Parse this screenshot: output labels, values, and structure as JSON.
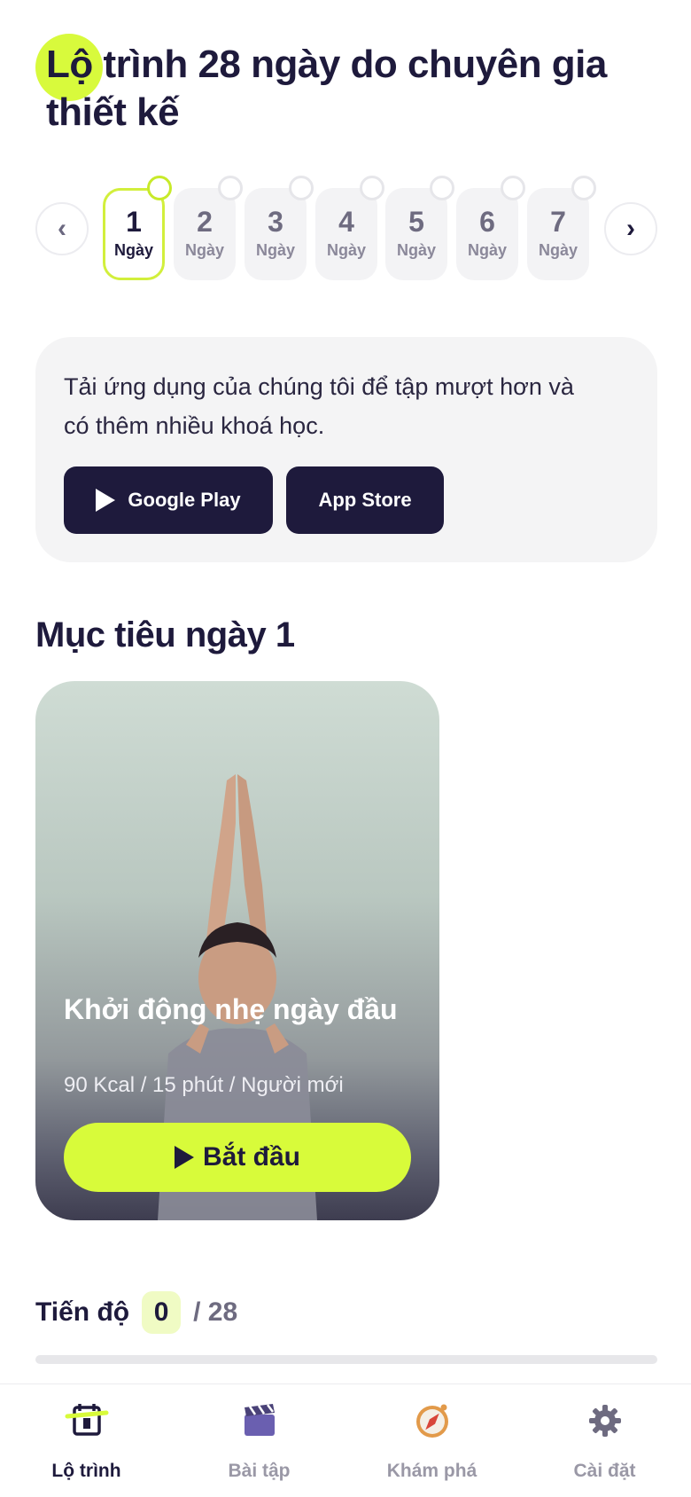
{
  "header": {
    "title": "Lộ trình 28 ngày do chuyên gia thiết kế"
  },
  "day_selector": {
    "prev_symbol": "‹",
    "next_symbol": "›",
    "days": [
      {
        "number": "1",
        "label": "Ngày",
        "active": true
      },
      {
        "number": "2",
        "label": "Ngày",
        "active": false
      },
      {
        "number": "3",
        "label": "Ngày",
        "active": false
      },
      {
        "number": "4",
        "label": "Ngày",
        "active": false
      },
      {
        "number": "5",
        "label": "Ngày",
        "active": false
      },
      {
        "number": "6",
        "label": "Ngày",
        "active": false
      },
      {
        "number": "7",
        "label": "Ngày",
        "active": false
      }
    ]
  },
  "promo": {
    "text": "Tải ứng dụng của chúng tôi để tập mượt hơn và có thêm nhiều khoá học.",
    "google_play_label": "Google Play",
    "app_store_label": "App Store"
  },
  "goal": {
    "title": "Mục tiêu ngày 1",
    "workout": {
      "name": "Khởi động nhẹ ngày đầu",
      "meta": "90 Kcal / 15 phút / Người mới",
      "start_label": "Bắt đầu"
    }
  },
  "progress": {
    "label": "Tiến độ",
    "completed": "0",
    "total": "/ 28",
    "fraction": 0
  },
  "tabs": [
    {
      "label": "Lộ trình",
      "icon": "calendar-icon",
      "active": true
    },
    {
      "label": "Bài tập",
      "icon": "clapperboard-icon",
      "active": false
    },
    {
      "label": "Khám phá",
      "icon": "compass-icon",
      "active": false
    },
    {
      "label": "Cài đặt",
      "icon": "gear-icon",
      "active": false
    }
  ],
  "colors": {
    "accent": "#d8fb3a",
    "primary_dark": "#1e1a3c",
    "muted": "#9a98a6"
  }
}
